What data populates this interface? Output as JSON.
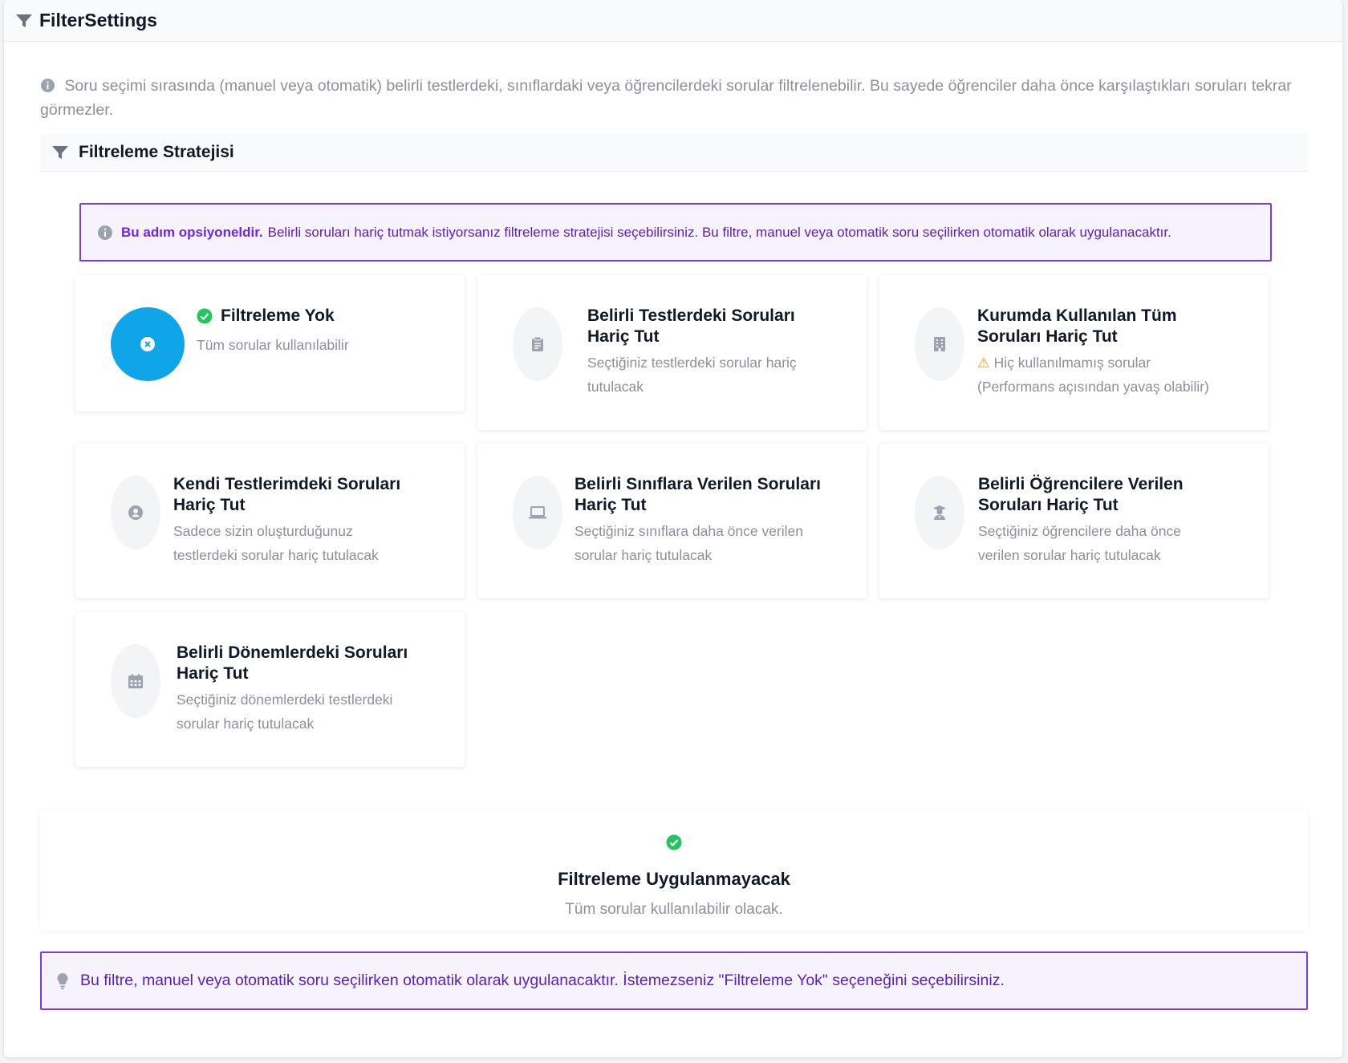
{
  "header": {
    "title": "FilterSettings"
  },
  "intro": "Soru seçimi sırasında (manuel veya otomatik) belirli testlerdeki, sınıflardaki veya öğrencilerdeki sorular filtrelenebilir. Bu sayede öğrenciler daha önce karşılaştıkları soruları tekrar görmezler.",
  "strategy": {
    "title": "Filtreleme Stratejisi"
  },
  "notice": {
    "bold": "Bu adım opsiyoneldir.",
    "text": "Belirli soruları hariç tutmak istiyorsanız filtreleme stratejisi seçebilirsiniz. Bu filtre, manuel veya otomatik soru seçilirken otomatik olarak uygulanacaktır."
  },
  "options": [
    {
      "title": "Filtreleme Yok",
      "desc": "Tüm sorular kullanılabilir",
      "icon": "x-circle-icon",
      "selected": true
    },
    {
      "title_1": "Belirli Testlerdeki Soruları",
      "title_2": "Hariç Tut",
      "desc_1": "Seçtiğiniz testlerdeki sorular hariç",
      "desc_2": "tutulacak",
      "icon": "clipboard-icon"
    },
    {
      "title_1": "Kurumda Kullanılan Tüm",
      "title_2": "Soruları Hariç Tut",
      "warn": "⚠",
      "desc_1": "Hiç kullanılmamış sorular",
      "desc_2": "(Performans açısından yavaş olabilir)",
      "icon": "building-icon"
    },
    {
      "title_1": "Kendi Testlerimdeki Soruları",
      "title_2": "Hariç Tut",
      "desc_1": "Sadece sizin oluşturduğunuz",
      "desc_2": "testlerdeki sorular hariç tutulacak",
      "icon": "user-circle-icon"
    },
    {
      "title_1": "Belirli Sınıflara Verilen Soruları",
      "title_2": "Hariç Tut",
      "desc_1": "Seçtiğiniz sınıflara daha önce verilen",
      "desc_2": "sorular hariç tutulacak",
      "icon": "laptop-icon"
    },
    {
      "title_1": "Belirli Öğrencilere Verilen",
      "title_2": "Soruları Hariç Tut",
      "desc_1": "Seçtiğiniz öğrencilere daha önce",
      "desc_2": "verilen sorular hariç tutulacak",
      "icon": "graduate-icon"
    },
    {
      "title_1": "Belirli Dönemlerdeki Soruları",
      "title_2": "Hariç Tut",
      "desc_1": "Seçtiğiniz dönemlerdeki testlerdeki",
      "desc_2": "sorular hariç tutulacak",
      "icon": "calendar-icon"
    }
  ],
  "result": {
    "title": "Filtreleme Uygulanmayacak",
    "desc": "Tüm sorular kullanılabilir olacak."
  },
  "tip": {
    "text": "Bu filtre, manuel veya otomatik soru seçilirken otomatik olarak uygulanacaktır. İstemezseniz \"Filtreleme Yok\" seçeneğini seçebilirsiniz."
  },
  "colors": {
    "accent": "#7c3aed",
    "selected": "#0ea5e9",
    "success": "#22c55e",
    "muted": "#8b909a"
  }
}
